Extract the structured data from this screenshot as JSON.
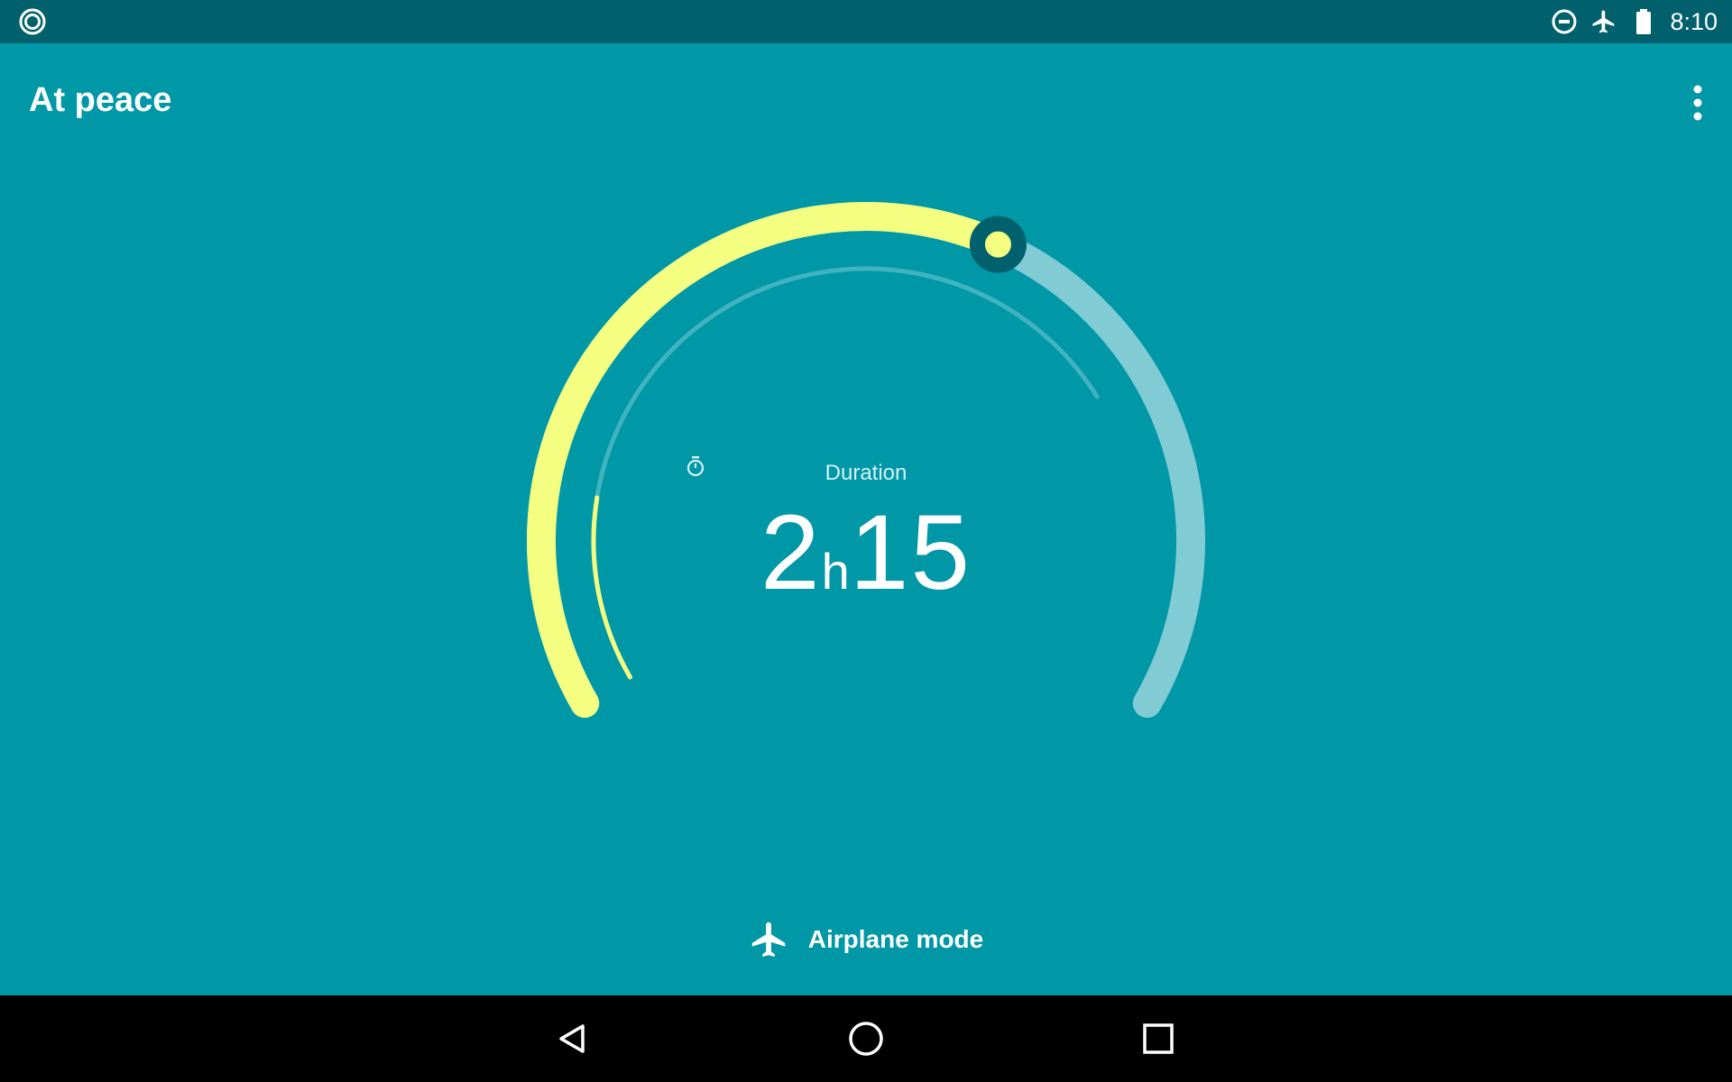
{
  "status_bar": {
    "left_icon": "circle-notification-icon",
    "right_icons": [
      "do-not-disturb-icon",
      "airplane-mode-icon",
      "battery-full-icon"
    ],
    "time": "8:10"
  },
  "app_bar": {
    "title": "At peace",
    "menu_icon": "more-vert-icon"
  },
  "dial": {
    "label_icon": "timer-icon",
    "label": "Duration",
    "hours": "2",
    "hours_unit": "h",
    "minutes": "15",
    "progress_fraction": 0.6,
    "inner_progress_fraction": 0.22,
    "colors": {
      "progress": "#f4ff81",
      "track": "#80cbd4",
      "handle": "#00606b",
      "inner_track": "#40b3c1"
    }
  },
  "mode": {
    "icon": "airplane-icon",
    "label": "Airplane mode"
  },
  "nav_bar": {
    "buttons": [
      "back-icon",
      "home-icon",
      "recents-icon"
    ]
  },
  "colors": {
    "background": "#0097a7",
    "status_bar": "#00606b",
    "nav_bar": "#000000",
    "text": "#ffffff"
  }
}
